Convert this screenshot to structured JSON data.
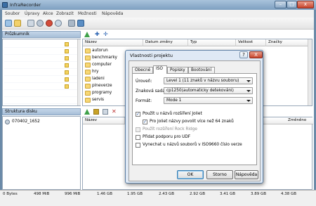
{
  "window": {
    "title": "InfraRecorder"
  },
  "menu": [
    "Soubor",
    "Úpravy",
    "Akce",
    "Zobrazit",
    "Možnosti",
    "Nápověda"
  ],
  "explorer": {
    "title": "Průzkumník"
  },
  "files": {
    "columns": [
      "Název",
      "Datum změny",
      "Typ",
      "Velikost",
      "Značky"
    ],
    "rows": [
      "autorun",
      "benchmarky",
      "computer",
      "hry",
      "ladeni",
      "plneverze",
      "programy",
      "servis"
    ]
  },
  "disc": {
    "title": "Struktura disku",
    "item": "070402_1652",
    "columns": [
      "Název",
      "Změněno"
    ]
  },
  "status": {
    "ticks": [
      "0 Bytes",
      "498 MiB",
      "996 MiB",
      "1.46 GB",
      "1.95 GB",
      "2.43 GB",
      "2.92 GB",
      "3.41 GB",
      "3.89 GB",
      "4.38 GB"
    ]
  },
  "dialog": {
    "title": "Vlastnosti projektu",
    "help_glyph": "?",
    "close_glyph": "X",
    "tabs": [
      "Obecné",
      "ISO",
      "Popisky",
      "Bootování"
    ],
    "active_tab": "ISO",
    "fields": {
      "level_label": "Úroveň:",
      "level_value": "Level 1 (11 znaků v názvu souboru)",
      "charset_label": "Znaková sada:",
      "charset_value": "cp1250(automaticky detekováni)",
      "format_label": "Formát:",
      "format_value": "Mode 1"
    },
    "checks": [
      {
        "label": "Použít u názvů rozšíření Joliet",
        "checked": "✓",
        "disabled": false
      },
      {
        "label": "Pro Joliet názvy povolit více než 64 znaků",
        "checked": "✓",
        "disabled": false
      },
      {
        "label": "Použít rozšíření Rock Ridge",
        "checked": "",
        "disabled": true
      },
      {
        "label": "Přidat podporu pro UDF",
        "checked": "",
        "disabled": false
      },
      {
        "label": "Vynechat u názvů souborů v ISO9660 číslo verze",
        "checked": "",
        "disabled": false
      }
    ],
    "buttons": {
      "ok": "OK",
      "cancel": "Storno",
      "help": "Nápověda"
    }
  },
  "colors": {
    "accent": "#3c7fb1",
    "folder": "#f7d774"
  }
}
